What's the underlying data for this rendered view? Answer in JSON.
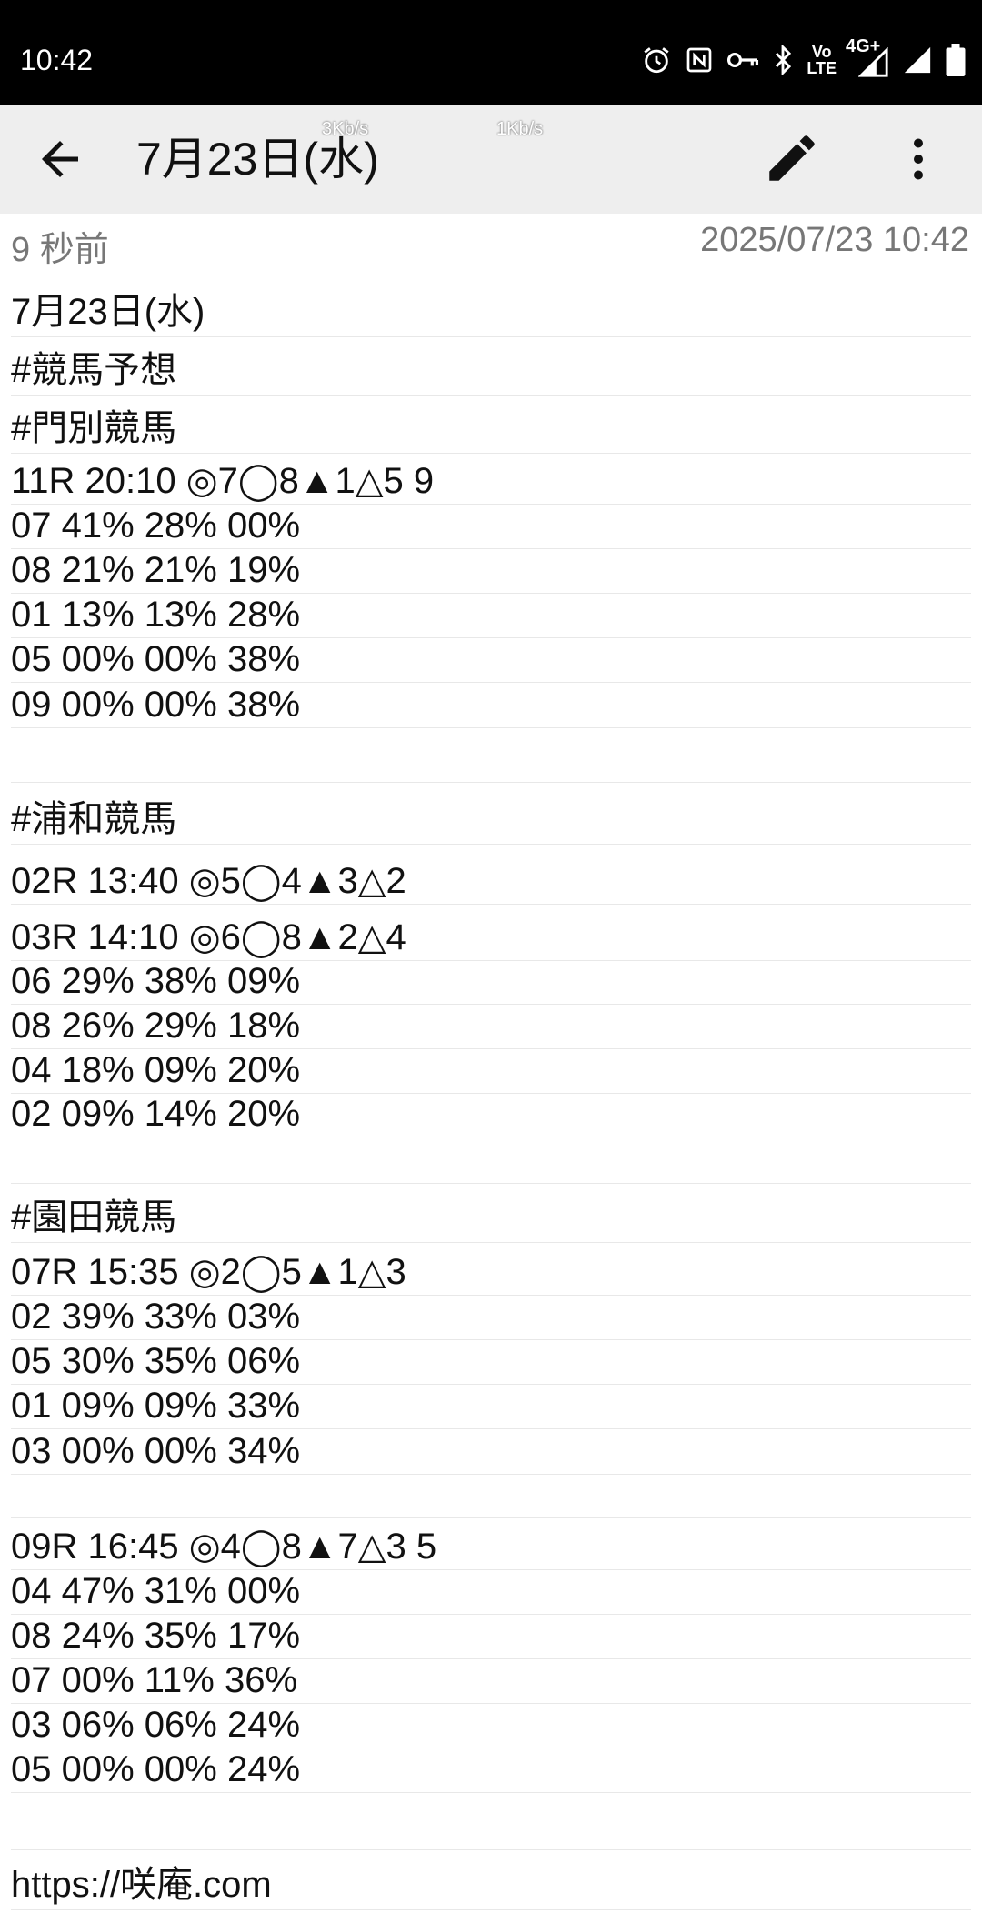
{
  "status_bar": {
    "time": "10:42",
    "network_type": "4G+",
    "volte_label_top": "Vo",
    "volte_label_bottom": "LTE",
    "icons": [
      "alarm-icon",
      "nfc-icon",
      "vpn-key-icon",
      "bluetooth-icon",
      "volte-icon",
      "signal-icon",
      "signal-icon",
      "battery-icon"
    ]
  },
  "app_bar": {
    "title": "7月23日(水)",
    "net_speed_1": "3Kb/s",
    "net_speed_2": "1Kb/s",
    "back_icon": "arrow-back-icon",
    "edit_icon": "pencil-icon",
    "more_icon": "more-vert-icon"
  },
  "meta": {
    "relative_time": "9 秒前",
    "timestamp": "2025/07/23 10:42"
  },
  "note_lines": [
    "7月23日(水)",
    "#競馬予想",
    "#門別競馬",
    "11R 20:10 ◎7◯8▲1△5 9",
    "07 41% 28% 00%",
    "08 21% 21% 19%",
    "01 13% 13% 28%",
    "05 00% 00% 38%",
    "09 00% 00% 38%",
    "",
    "#浦和競馬",
    "02R 13:40 ◎5◯4▲3△2",
    "03R 14:10 ◎6◯8▲2△4",
    "06 29% 38% 09%",
    "08 26% 29% 18%",
    "04 18% 09% 20%",
    "02 09% 14% 20%",
    "",
    "#園田競馬",
    "07R 15:35 ◎2◯5▲1△3",
    "02 39% 33% 03%",
    "05 30% 35% 06%",
    "01 09% 09% 33%",
    "03 00% 00% 34%",
    "",
    "09R 16:45 ◎4◯8▲7△3 5",
    "04 47% 31% 00%",
    "08 24% 35% 17%",
    "07 00% 11% 36%",
    "03 06% 06% 24%",
    "05 00% 00% 24%",
    "",
    "https://咲庵.com"
  ]
}
